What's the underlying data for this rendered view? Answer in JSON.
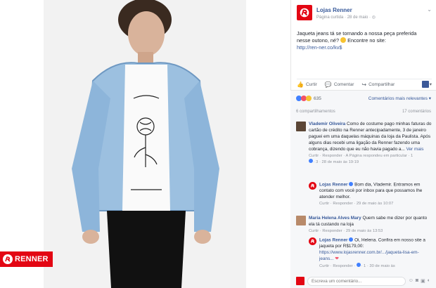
{
  "brand": {
    "name": "RENNER"
  },
  "post": {
    "page_name": "Lojas Renner",
    "meta": "Página curtida · 28 de maio · ",
    "privacy_icon": "globe-icon",
    "text": "Jaqueta jeans tá se tornando a nossa peça preferida nesse outono, né?",
    "text_after_emoji": "Encontre no site:",
    "link": "http://ren-ner.co/kv$",
    "menu_icon": "chevron-down-icon"
  },
  "actions": {
    "like": "Curtir",
    "comment": "Comentar",
    "share": "Compartilhar"
  },
  "feedback": {
    "reaction_count": "635",
    "sort": "Comentários mais relevantes ▾",
    "shares": "6 compartilhamentos",
    "comments_count": "17 comentários"
  },
  "comments": [
    {
      "author": "Vlademir Oliveira",
      "text": "Como de costume pago minhas faturas do cartão de crédito na Renner antecipadamente, 3 de janeiro paguei em uma daquelas máquinas da loja da Paulista. Após alguns dias recebi uma ligação da Renner fazendo uma cobrança, dizendo que eu não havia pagado a...",
      "more": "Ver mais",
      "meta": "Curtir · Responder · ",
      "meta_link": "A Página respondeu em particular",
      "meta_tail": " · 1",
      "meta_line2": "· 3 · 28 de maio às 19:19",
      "reply": {
        "author": "Lojas Renner",
        "text": "Bom dia, Vlademir. Entramos em contato com você por inbox para que possamos lhe atender melhor.",
        "meta": "Curtir · Responder · 29 de maio às 10:07"
      }
    },
    {
      "author": "Maria Helena Alves Mary",
      "text": "Quem sabe me dizer por quanto ela tá custando na loja",
      "meta": "Curtir · Responder · 29 de maio às 13:53",
      "reply": {
        "author": "Lojas Renner",
        "text": "Oi, Helena. Confira em nosso site a jaqueta por R$179,00:",
        "link": "https://www.lojasrenner.com.br/.../jaqueta-lisa-em-jeans...",
        "meta": "Curtir · Responder · ",
        "meta_tail": " · 1 · 30 de maio às"
      }
    }
  ],
  "composer": {
    "placeholder": "Escreva um comentário..."
  }
}
